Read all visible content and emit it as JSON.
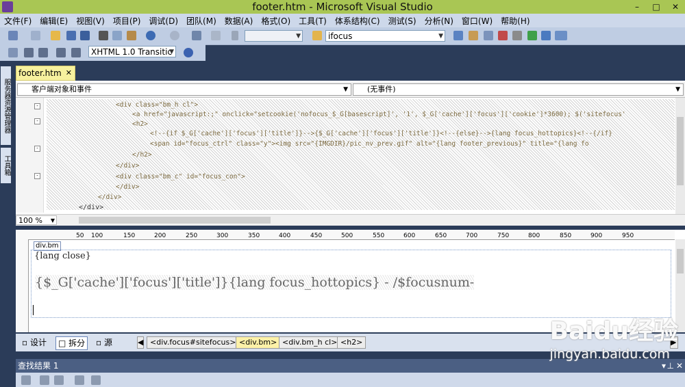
{
  "window": {
    "title": "footer.htm - Microsoft Visual Studio"
  },
  "menu": [
    "文件(F)",
    "编辑(E)",
    "视图(V)",
    "项目(P)",
    "调试(D)",
    "团队(M)",
    "数据(A)",
    "格式(O)",
    "工具(T)",
    "体系结构(C)",
    "测试(S)",
    "分析(N)",
    "窗口(W)",
    "帮助(H)"
  ],
  "toolbar": {
    "search_value": "ifocus",
    "doctype_value": "XHTML 1.0 Transitic"
  },
  "side_tabs": [
    "服务器资源管理器",
    "工具箱"
  ],
  "document_tab": {
    "label": "footer.htm",
    "close": "✕"
  },
  "nav": {
    "left": "客户端对象和事件",
    "right": "(无事件)"
  },
  "code": {
    "lines": [
      "<div class=\"bm_h cl\">",
      "<a href=\"javascript:;\" onclick=\"setcookie('nofocus_$_G[basescript]', '1', $_G['cache']['focus']['cookie']*3600); $('sitefocus'",
      "<h2>",
      "<!--{if $_G['cache']['focus']['title']}-->{$_G['cache']['focus']['title']}<!--{else}-->{lang focus_hottopics}<!--{/if}",
      "<span id=\"focus_ctrl\" class=\"y\"><img src=\"{IMGDIR}/pic_nv_prev.gif\" alt=\"{lang footer_previous}\" title=\"{lang fo",
      "</h2>",
      "</div>",
      "<div class=\"bm_c\" id=\"focus_con\">",
      "</div>",
      "</div>"
    ],
    "closing": "</div>"
  },
  "zoom": "100 %",
  "ruler": {
    "ticks": [
      "50",
      "100",
      "150",
      "200",
      "250",
      "300",
      "350",
      "400",
      "450",
      "500",
      "550",
      "600",
      "650",
      "700",
      "750",
      "800",
      "850",
      "900",
      "950"
    ]
  },
  "design": {
    "tag_label": "div.bm",
    "lang_close": "{lang close}",
    "big_text": "{$_G['cache']['focus']['title']}{lang focus_hottopics}  -  /$focusnum-"
  },
  "view_buttons": {
    "design": "设计",
    "split": "拆分",
    "source": "源"
  },
  "breadcrumbs": [
    "<div.focus#sitefocus>",
    "<div.bm>",
    "<div.bm_h cl>",
    "<h2>"
  ],
  "find_panel": {
    "title": "查找结果 1"
  },
  "watermark": {
    "logo": "Baidu经验",
    "url": "jingyan.baidu.com"
  }
}
